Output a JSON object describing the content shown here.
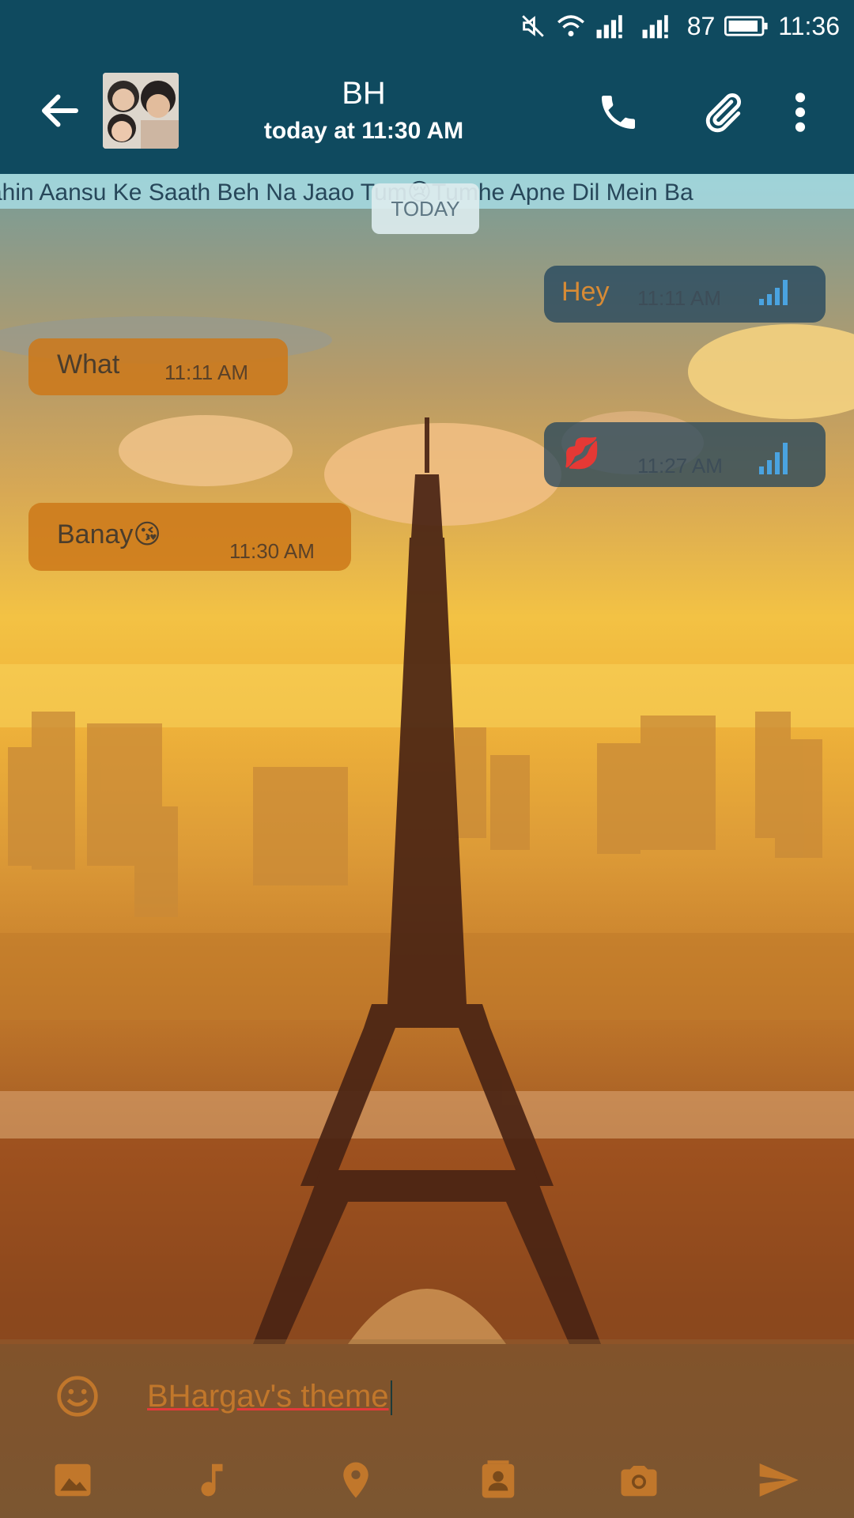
{
  "status_bar": {
    "battery": "87",
    "time": "11:36"
  },
  "toolbar": {
    "contact_name": "BH",
    "last_seen": "today at 11:30 AM"
  },
  "ticker_text": "ahin Aansu Ke Saath Beh Na Jaao Tum😢Tumhe Apne Dil Mein Ba",
  "date_chip": "TODAY",
  "messages": [
    {
      "direction": "out",
      "text": "Hey",
      "time": "11:11 AM"
    },
    {
      "direction": "in",
      "text": "What",
      "time": "11:11 AM"
    },
    {
      "direction": "out",
      "text": "💋",
      "time": "11:27 AM"
    },
    {
      "direction": "in",
      "text": "Banay😘",
      "time": "11:30 AM"
    }
  ],
  "compose": {
    "input_value": "BHargav's theme",
    "icons": [
      "emoji-icon",
      "image-icon",
      "music-icon",
      "location-icon",
      "contact-icon",
      "camera-icon",
      "send-icon"
    ]
  },
  "colors": {
    "toolbar": "#0f4a5f",
    "incoming_bubble": "#cd7819",
    "outgoing_bubble": "#1a405c",
    "accent_icon": "#c1772b"
  }
}
